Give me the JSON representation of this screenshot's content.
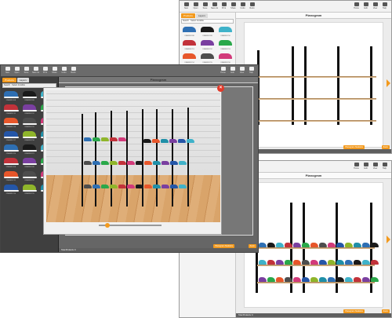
{
  "app": {
    "toolbar": [
      {
        "label": "New",
        "icon": "new-icon"
      },
      {
        "label": "Open",
        "icon": "folder-icon"
      },
      {
        "label": "Save",
        "icon": "save-icon"
      },
      {
        "label": "Save As",
        "icon": "save-as-icon"
      },
      {
        "label": "Print",
        "icon": "print-icon"
      },
      {
        "label": "Share",
        "icon": "share-icon"
      },
      {
        "label": "Undo",
        "icon": "undo-icon"
      },
      {
        "label": "Redo",
        "icon": "redo-icon"
      }
    ],
    "toolbar_right": [
      {
        "label": "Home",
        "icon": "home-icon"
      },
      {
        "label": "Edit",
        "icon": "edit-icon"
      },
      {
        "label": "View",
        "icon": "view-icon"
      },
      {
        "label": "Help",
        "icon": "help-icon"
      }
    ],
    "tabs": [
      "Products",
      "Layers"
    ],
    "search_label": "Search",
    "filter_label": "Select Invisible",
    "planogram_title": "Planogram",
    "status_text": "Total Products: 0",
    "status_right": "CRKP Total: 90.6",
    "stats_button": "Planogram Statistics",
    "zoom_label": "Zoom"
  },
  "colors": {
    "accent": "#f39a1e",
    "close": "#e13a2a",
    "shoes": [
      "#2e6fb3",
      "#1a1a1a",
      "#3fb2c9",
      "#c2323a",
      "#7a3fa0",
      "#2aa84a",
      "#e7562a",
      "#4d4d4d",
      "#d23a7a",
      "#2456a8",
      "#8fb52a",
      "#1f8fa8"
    ]
  },
  "products": [
    "2ZA9891208",
    "2ZA9891209",
    "2ZA9891210",
    "2ZA9891211",
    "2ZA9891212",
    "2ZA9891213",
    "2ZA9891214",
    "2ZA9891215",
    "2ZA9891216",
    "2ZA9891217",
    "2ZA9891218",
    "2ZA9891219",
    "2ZA9891220",
    "2ZA9891221",
    "2ZA9891222"
  ]
}
